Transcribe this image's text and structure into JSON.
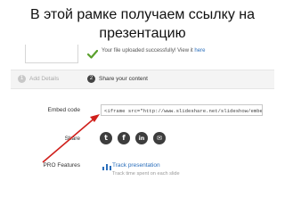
{
  "caption": {
    "line1": "В этой рамке получаем ссылку на",
    "line2": "презентацию"
  },
  "upload": {
    "message": "Your file uploaded successfully! View it",
    "link": "here"
  },
  "steps": [
    {
      "number": "1",
      "label": "Add Details"
    },
    {
      "number": "2",
      "label": "Share your content"
    }
  ],
  "embed": {
    "label": "Embed code",
    "value": "<iframe src=\"http://www.slideshare.net/slideshow/embed_code"
  },
  "share": {
    "label": "Share",
    "icons": [
      {
        "name": "twitter-icon",
        "glyph": "t"
      },
      {
        "name": "facebook-icon",
        "glyph": "f"
      },
      {
        "name": "linkedin-icon",
        "glyph": "in"
      },
      {
        "name": "email-icon",
        "glyph": "✉"
      }
    ]
  },
  "pro": {
    "label": "PRO Features",
    "link": "Track presentation",
    "sub": "Track time spent on each slide"
  },
  "colors": {
    "link": "#2a6ebb",
    "check": "#5aa02c",
    "arrow": "#d0201c",
    "icon_bg": "#3d3d3d"
  }
}
